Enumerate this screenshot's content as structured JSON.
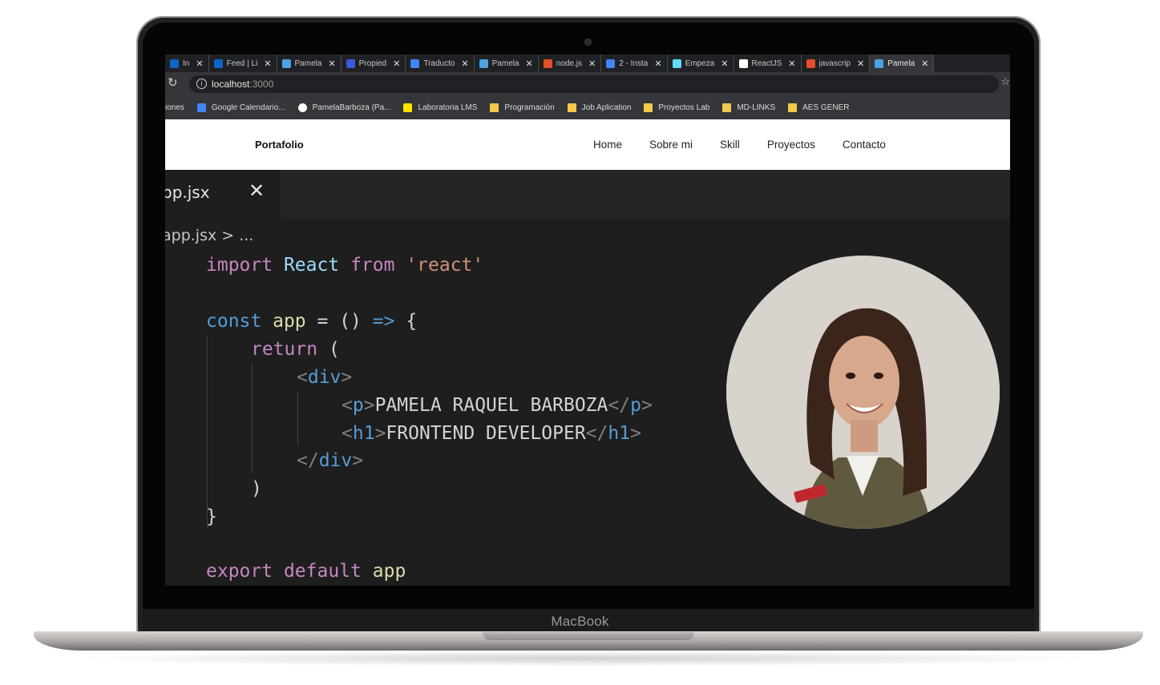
{
  "device": {
    "brand": "MacBook"
  },
  "browser": {
    "tabs": [
      {
        "label": "In",
        "color": "#0a66c2",
        "active": false
      },
      {
        "label": "Feed | Li",
        "color": "#0a66c2",
        "active": false
      },
      {
        "label": "Pamela",
        "color": "#4aa3df",
        "active": false
      },
      {
        "label": "Propied",
        "color": "#3b5bdb",
        "active": false
      },
      {
        "label": "Traducto",
        "color": "#4285f4",
        "active": false
      },
      {
        "label": "Pamela",
        "color": "#4aa3df",
        "active": false
      },
      {
        "label": "node.js",
        "color": "#e34f26",
        "active": false
      },
      {
        "label": "2 - Insta",
        "color": "#4285f4",
        "active": false
      },
      {
        "label": "Empeza",
        "color": "#61dafb",
        "active": false
      },
      {
        "label": "ReactJS",
        "color": "#ffffff",
        "active": false
      },
      {
        "label": "javascrip",
        "color": "#e34f26",
        "active": false
      },
      {
        "label": "Pamela",
        "color": "#4aa3df",
        "active": true
      }
    ],
    "close_glyph": "✕",
    "address": {
      "host": "localhost",
      "port": ":3000"
    },
    "bookmarks": [
      {
        "label": "iones",
        "type": "none",
        "color": ""
      },
      {
        "label": "Google Calendario...",
        "type": "icon",
        "color": "#4285f4"
      },
      {
        "label": "PamelaBarboza (Pa...",
        "type": "github",
        "color": "#ffffff"
      },
      {
        "label": "Laboratoria LMS",
        "type": "icon",
        "color": "#ffe600"
      },
      {
        "label": "Programación",
        "type": "folder",
        "color": "#f2c94c"
      },
      {
        "label": "Job Aplication",
        "type": "folder",
        "color": "#f2c94c"
      },
      {
        "label": "Proyectos Lab",
        "type": "folder",
        "color": "#f2c94c"
      },
      {
        "label": "MD-LINKS",
        "type": "folder",
        "color": "#f2c94c"
      },
      {
        "label": "AES GENER",
        "type": "folder",
        "color": "#f2c94c"
      }
    ]
  },
  "site": {
    "logo": "Portafolio",
    "nav": [
      "Home",
      "Sobre mi",
      "Skill",
      "Proyectos",
      "Contacto"
    ]
  },
  "editor": {
    "file_tab": "pp.jsx",
    "close_glyph": "✕",
    "breadcrumb": "app.jsx > ...",
    "lines": {
      "l1_kw1": "import",
      "l1_name": "React",
      "l1_kw2": "from",
      "l1_str": "'react'",
      "l2_decl": "const",
      "l2_name": "app",
      "l2_eq": " = ",
      "l2_paren": "()",
      "l2_arrow": "=>",
      "l2_brace": "{",
      "l3_kw": "return",
      "l3_paren": "(",
      "l4_open": "div",
      "l5_tag": "p",
      "l5_text": "PAMELA RAQUEL BARBOZA",
      "l6_tag": "h1",
      "l6_text": "FRONTEND DEVELOPER",
      "l7_close": "div",
      "l8_paren": ")",
      "l9_brace": "}",
      "l10_kw1": "export",
      "l10_kw2": "default",
      "l10_name": "app"
    }
  },
  "colors": {
    "keyword": "#c586c0",
    "declaration": "#569cd6",
    "identifier": "#dcdcaa",
    "string": "#ce9178",
    "editor_bg": "#1e1e1e"
  }
}
